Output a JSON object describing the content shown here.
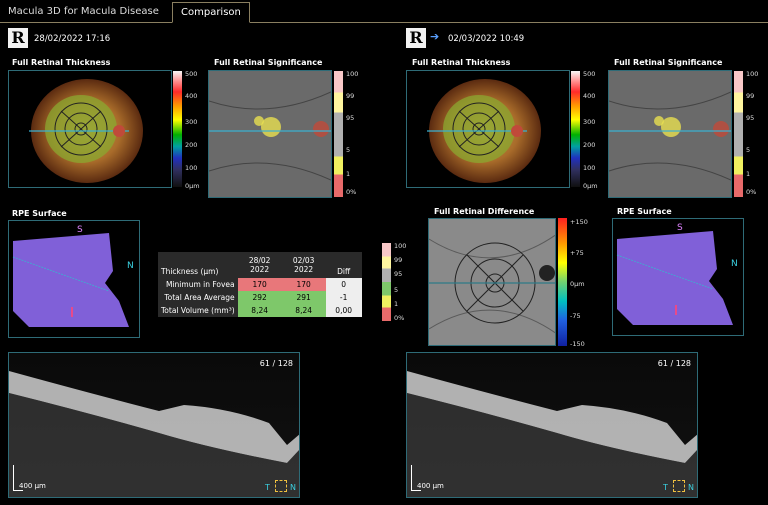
{
  "tabs": [
    {
      "label": "Macula 3D for Macula Disease"
    },
    {
      "label": "Comparison"
    }
  ],
  "left": {
    "eye": "R",
    "date": "28/02/2022  17:16",
    "thickness_label": "Full Retinal Thickness",
    "significance_label": "Full Retinal Significance",
    "rpe_label": "RPE Surface",
    "thickness_scale": [
      "500",
      "400",
      "300",
      "200",
      "100",
      "0µm"
    ],
    "significance_scale": [
      "100",
      "99",
      "95",
      "5",
      "1",
      "0%"
    ],
    "rpe_s": "S",
    "rpe_n": "N",
    "oct_counter": "61 / 128",
    "oct_scale": "400 µm",
    "oct_t": "T",
    "oct_n": "N"
  },
  "right": {
    "eye": "R",
    "date": "02/03/2022  10:49",
    "thickness_label": "Full Retinal Thickness",
    "significance_label": "Full Retinal Significance",
    "difference_label": "Full Retinal Difference",
    "rpe_label": "RPE Surface",
    "thickness_scale": [
      "500",
      "400",
      "300",
      "200",
      "100",
      "0µm"
    ],
    "significance_scale": [
      "100",
      "99",
      "95",
      "5",
      "1",
      "0%"
    ],
    "difference_scale": [
      "+150",
      "+75",
      "0µm",
      "-75",
      "-150"
    ],
    "rpe_s": "S",
    "rpe_n": "N",
    "oct_counter": "61 / 128",
    "oct_scale": "400 µm",
    "oct_t": "T",
    "oct_n": "N"
  },
  "table": {
    "headers": [
      "Thickness (µm)",
      "28/02\n2022",
      "02/03\n2022",
      "Diff"
    ],
    "header_c1_l1": "28/02",
    "header_c1_l2": "2022",
    "header_c2_l1": "02/03",
    "header_c2_l2": "2022",
    "rows": [
      {
        "label": "Minimum in Fovea",
        "v1": "170",
        "v2": "170",
        "diff": "0"
      },
      {
        "label": "Total Area Average",
        "v1": "292",
        "v2": "291",
        "diff": "-1"
      },
      {
        "label": "Total Volume (mm³)",
        "v1": "8,24",
        "v2": "8,24",
        "diff": "0,00"
      }
    ],
    "legend": [
      "100",
      "99",
      "95",
      "5",
      "1",
      "0%"
    ]
  },
  "colors": {
    "accent": "#2e6b77",
    "tab_border": "#8a7f60",
    "red": "#e8777a",
    "green": "#7ec86a",
    "rpe": "#8060d8"
  }
}
